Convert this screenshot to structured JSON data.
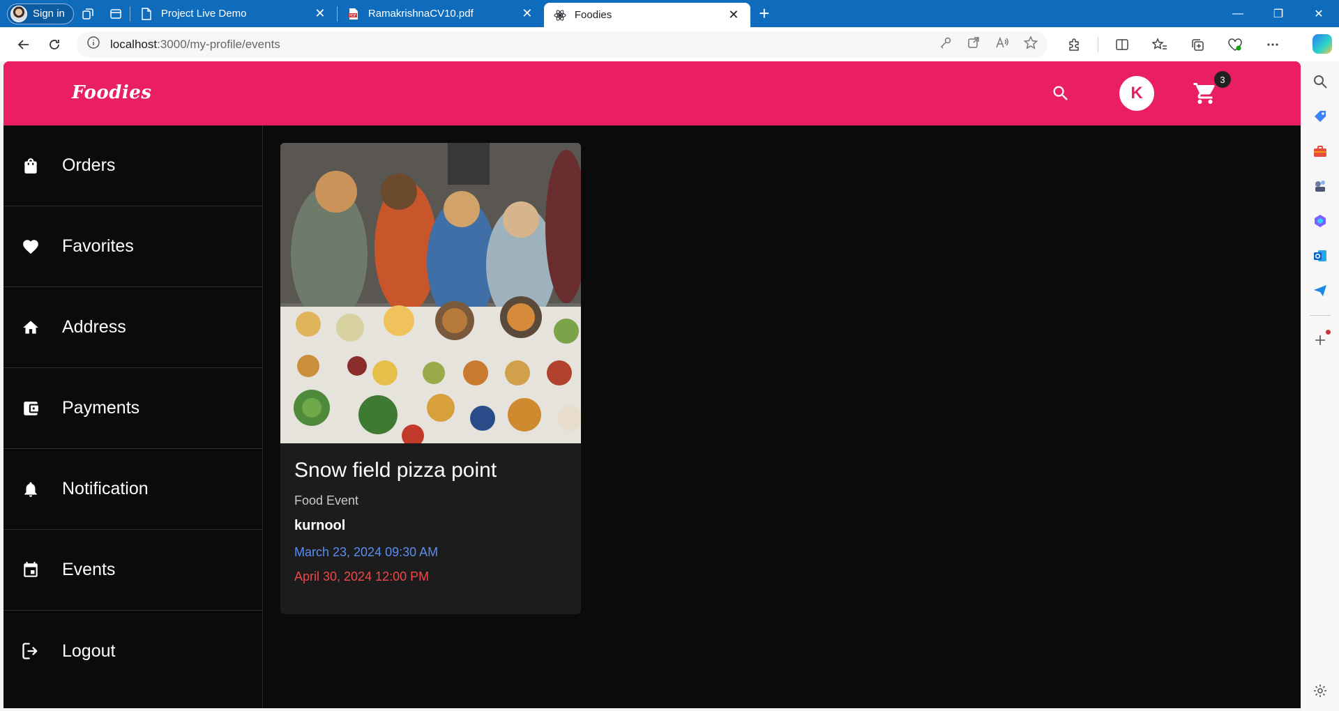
{
  "browser": {
    "profile_label": "Sign in",
    "tabs": [
      {
        "title": "Project Live Demo",
        "favicon": "page-icon",
        "active": false
      },
      {
        "title": "RamakrishnaCV10.pdf",
        "favicon": "pdf-icon",
        "active": false
      },
      {
        "title": "Foodies",
        "favicon": "react-icon",
        "active": true
      }
    ],
    "url_host": "localhost",
    "url_path": ":3000/my-profile/events",
    "accent": "#0f6cbd"
  },
  "app": {
    "logo": "Foodies",
    "avatar_letter": "K",
    "cart_count": "3",
    "brand_color": "#e91e63",
    "sidebar": [
      {
        "label": "Orders",
        "icon": "shopping-bag-icon"
      },
      {
        "label": "Favorites",
        "icon": "heart-icon"
      },
      {
        "label": "Address",
        "icon": "home-icon"
      },
      {
        "label": "Payments",
        "icon": "wallet-icon"
      },
      {
        "label": "Notification",
        "icon": "bell-icon"
      },
      {
        "label": "Events",
        "icon": "calendar-icon"
      },
      {
        "label": "Logout",
        "icon": "logout-icon"
      }
    ],
    "event_card": {
      "title": "Snow field pizza point",
      "type": "Food Event",
      "location": "kurnool",
      "start": "March 23, 2024 09:30 AM",
      "end": "April 30, 2024 12:00 PM",
      "start_color": "#5b8def",
      "end_color": "#f0474a"
    }
  }
}
